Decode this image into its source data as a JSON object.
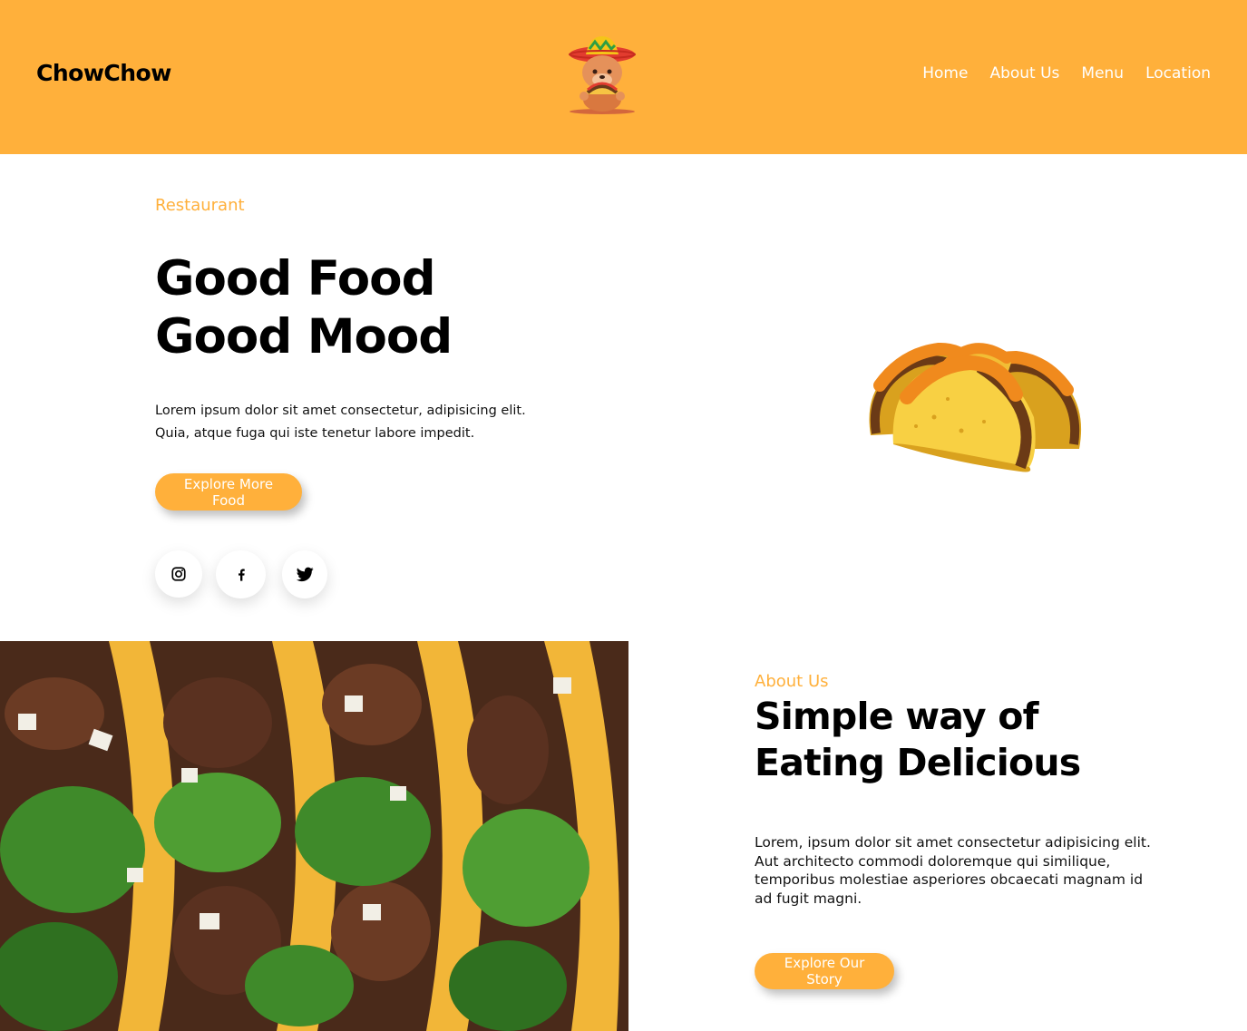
{
  "header": {
    "brand": "ChowChow",
    "nav": [
      "Home",
      "About Us",
      "Menu",
      "Location"
    ]
  },
  "hero": {
    "eyebrow": "Restaurant",
    "title_line1": "Good Food",
    "title_line2": "Good Mood",
    "text": "Lorem ipsum dolor sit amet consectetur, adipisicing elit. Quia, atque fuga qui iste tenetur labore impedit.",
    "button": "Explore More Food",
    "social": [
      "instagram-icon",
      "facebook-icon",
      "twitter-icon"
    ]
  },
  "about": {
    "eyebrow": "About Us",
    "title_line1": "Simple way of",
    "title_line2": "Eating Delicious",
    "text": "Lorem, ipsum dolor sit amet consectetur adipisicing elit. Aut architecto commodi doloremque qui similique, temporibus molestiae asperiores obcaecati magnam id ad fugit magni.",
    "button": "Explore Our Story"
  },
  "colors": {
    "accent": "#ffb03b",
    "text": "#000000",
    "background": "#ffffff"
  }
}
